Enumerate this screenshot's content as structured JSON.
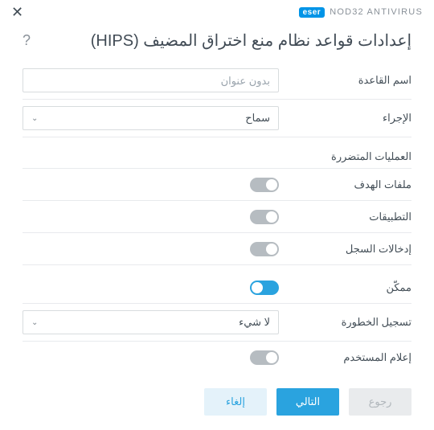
{
  "brand": {
    "logo": "eser",
    "product": "NOD32 ANTIVIRUS"
  },
  "title": "إعدادات قواعد نظام منع اختراق المضيف (HIPS)",
  "fields": {
    "rule_name_label": "اسم القاعدة",
    "rule_name_placeholder": "بدون عنوان",
    "action_label": "الإجراء",
    "action_value": "سماح",
    "affected_ops_header": "العمليات المتضررة",
    "target_files_label": "ملفات الهدف",
    "applications_label": "التطبيقات",
    "registry_entries_label": "إدخالات السجل",
    "enabled_label": "ممكّن",
    "severity_label": "تسجيل الخطورة",
    "severity_value": "لا شيء",
    "notify_user_label": "إعلام المستخدم"
  },
  "toggles": {
    "target_files": false,
    "applications": false,
    "registry_entries": false,
    "enabled": true,
    "notify_user": false
  },
  "buttons": {
    "back": "رجوع",
    "next": "التالي",
    "cancel": "إلغاء"
  }
}
